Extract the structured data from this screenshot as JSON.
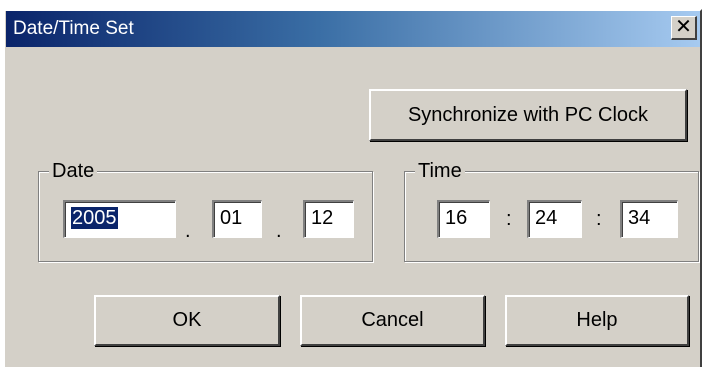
{
  "window": {
    "title": "Date/Time Set",
    "close_glyph": "✕"
  },
  "sync_button": {
    "label": "Synchronize with PC Clock"
  },
  "date": {
    "label": "Date",
    "year": "2005",
    "month": "01",
    "day": "12",
    "separator": "."
  },
  "time": {
    "label": "Time",
    "hour": "16",
    "minute": "24",
    "second": "34",
    "separator": ":"
  },
  "buttons": {
    "ok": "OK",
    "cancel": "Cancel",
    "help": "Help"
  },
  "colors": {
    "title_gradient_start": "#0a246a",
    "title_gradient_end": "#a6caf0",
    "dialog_bg": "#d4d0c8",
    "selection": "#0a246a"
  }
}
